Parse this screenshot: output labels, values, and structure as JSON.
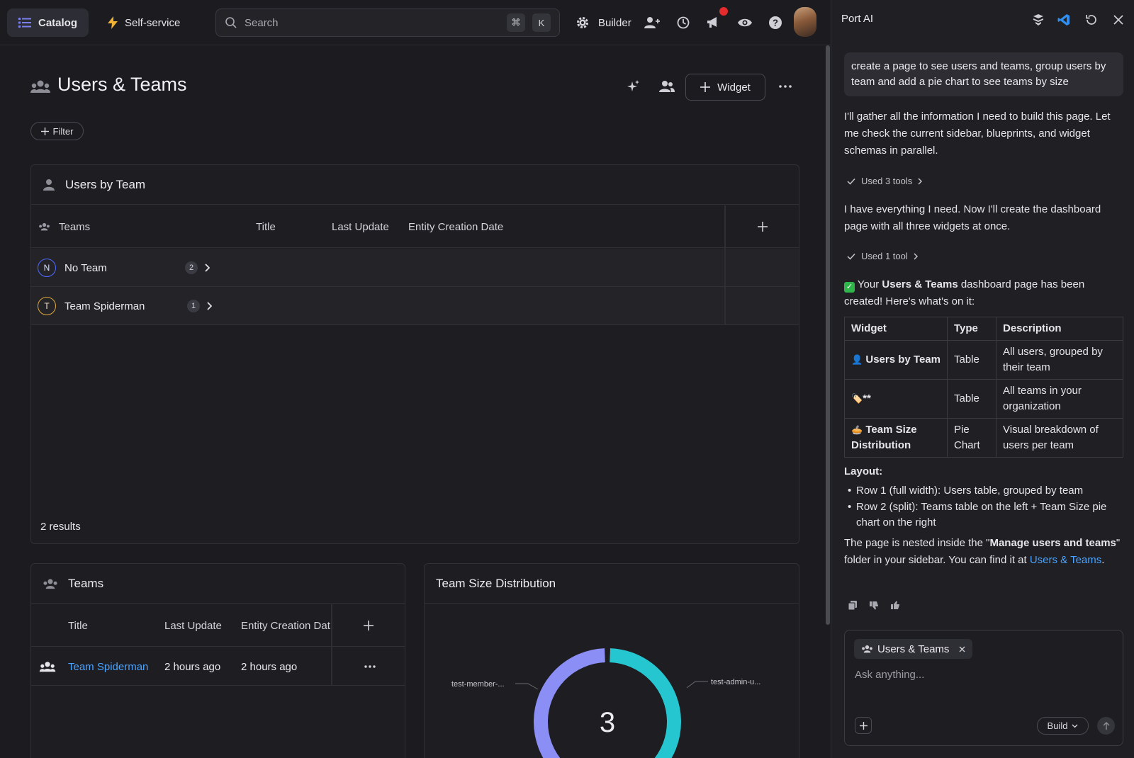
{
  "topbar": {
    "catalog_label": "Catalog",
    "self_service_label": "Self-service",
    "search_placeholder": "Search",
    "shortcut_cmd": "⌘",
    "shortcut_key": "K",
    "builder_label": "Builder"
  },
  "page": {
    "title": "Users & Teams",
    "widget_button": "Widget",
    "filter_button": "Filter"
  },
  "users_by_team": {
    "title": "Users by Team",
    "columns": [
      "Teams",
      "Title",
      "Last Update",
      "Entity Creation Date"
    ],
    "groups": [
      {
        "initial": "N",
        "name": "No Team",
        "count": "2",
        "color": "#4f6bff"
      },
      {
        "initial": "T",
        "name": "Team Spiderman",
        "count": "1",
        "color": "#e0a93a"
      }
    ],
    "results": "2 results"
  },
  "teams": {
    "title": "Teams",
    "columns": [
      "Title",
      "Last Update",
      "Entity Creation Dat"
    ],
    "rows": [
      {
        "title": "Team Spiderman",
        "last_update": "2 hours ago",
        "created": "2 hours ago"
      }
    ]
  },
  "team_size": {
    "title": "Team Size Distribution"
  },
  "chart_data": {
    "type": "pie",
    "title": "Team Size Distribution",
    "center_label": "3",
    "slices": [
      {
        "label": "test-member-...",
        "value": 1,
        "color": "#8b8ef5"
      },
      {
        "label": "test-admin-u...",
        "value": 1,
        "color": "#26c6d0"
      }
    ]
  },
  "ai_panel": {
    "title": "Port AI",
    "user_message": "create a page to see users and teams, group users by team and add a pie chart to see teams by size",
    "msg1": "I'll gather all the information I need to build this page. Let me check the current sidebar, blueprints, and widget schemas in parallel.",
    "tools1": "Used 3 tools",
    "msg2": "I have everything I need. Now I'll create the dashboard page with all three widgets at once.",
    "tools2": "Used 1 tool",
    "result_pre": "Your",
    "result_bold": "Users & Teams",
    "result_post": "dashboard page has been created! Here's what's on it:",
    "table_headers": [
      "Widget",
      "Type",
      "Description"
    ],
    "table_rows": [
      {
        "emoji": "👤",
        "widget": "Users by Team",
        "type": "Table",
        "desc": "All users, grouped by their team"
      },
      {
        "emoji": "🏷️",
        "widget": "**",
        "type": "Table",
        "desc": "All teams in your organization"
      },
      {
        "emoji": "🥧",
        "widget": "Team Size Distribution",
        "type": "Pie Chart",
        "desc": "Visual breakdown of users per team"
      }
    ],
    "layout_label": "Layout:",
    "bullets": [
      "Row 1 (full width): Users table, grouped by team",
      "Row 2 (split): Teams table on the left + Team Size pie chart on the right"
    ],
    "nested_pre": "The page is nested inside the \"",
    "nested_bold": "Manage users and teams",
    "nested_mid": "\" folder in your sidebar. You can find it at ",
    "nested_link": "Users & Teams",
    "nested_end": ".",
    "chip_label": "Users & Teams",
    "ask_placeholder": "Ask anything...",
    "build_label": "Build"
  }
}
